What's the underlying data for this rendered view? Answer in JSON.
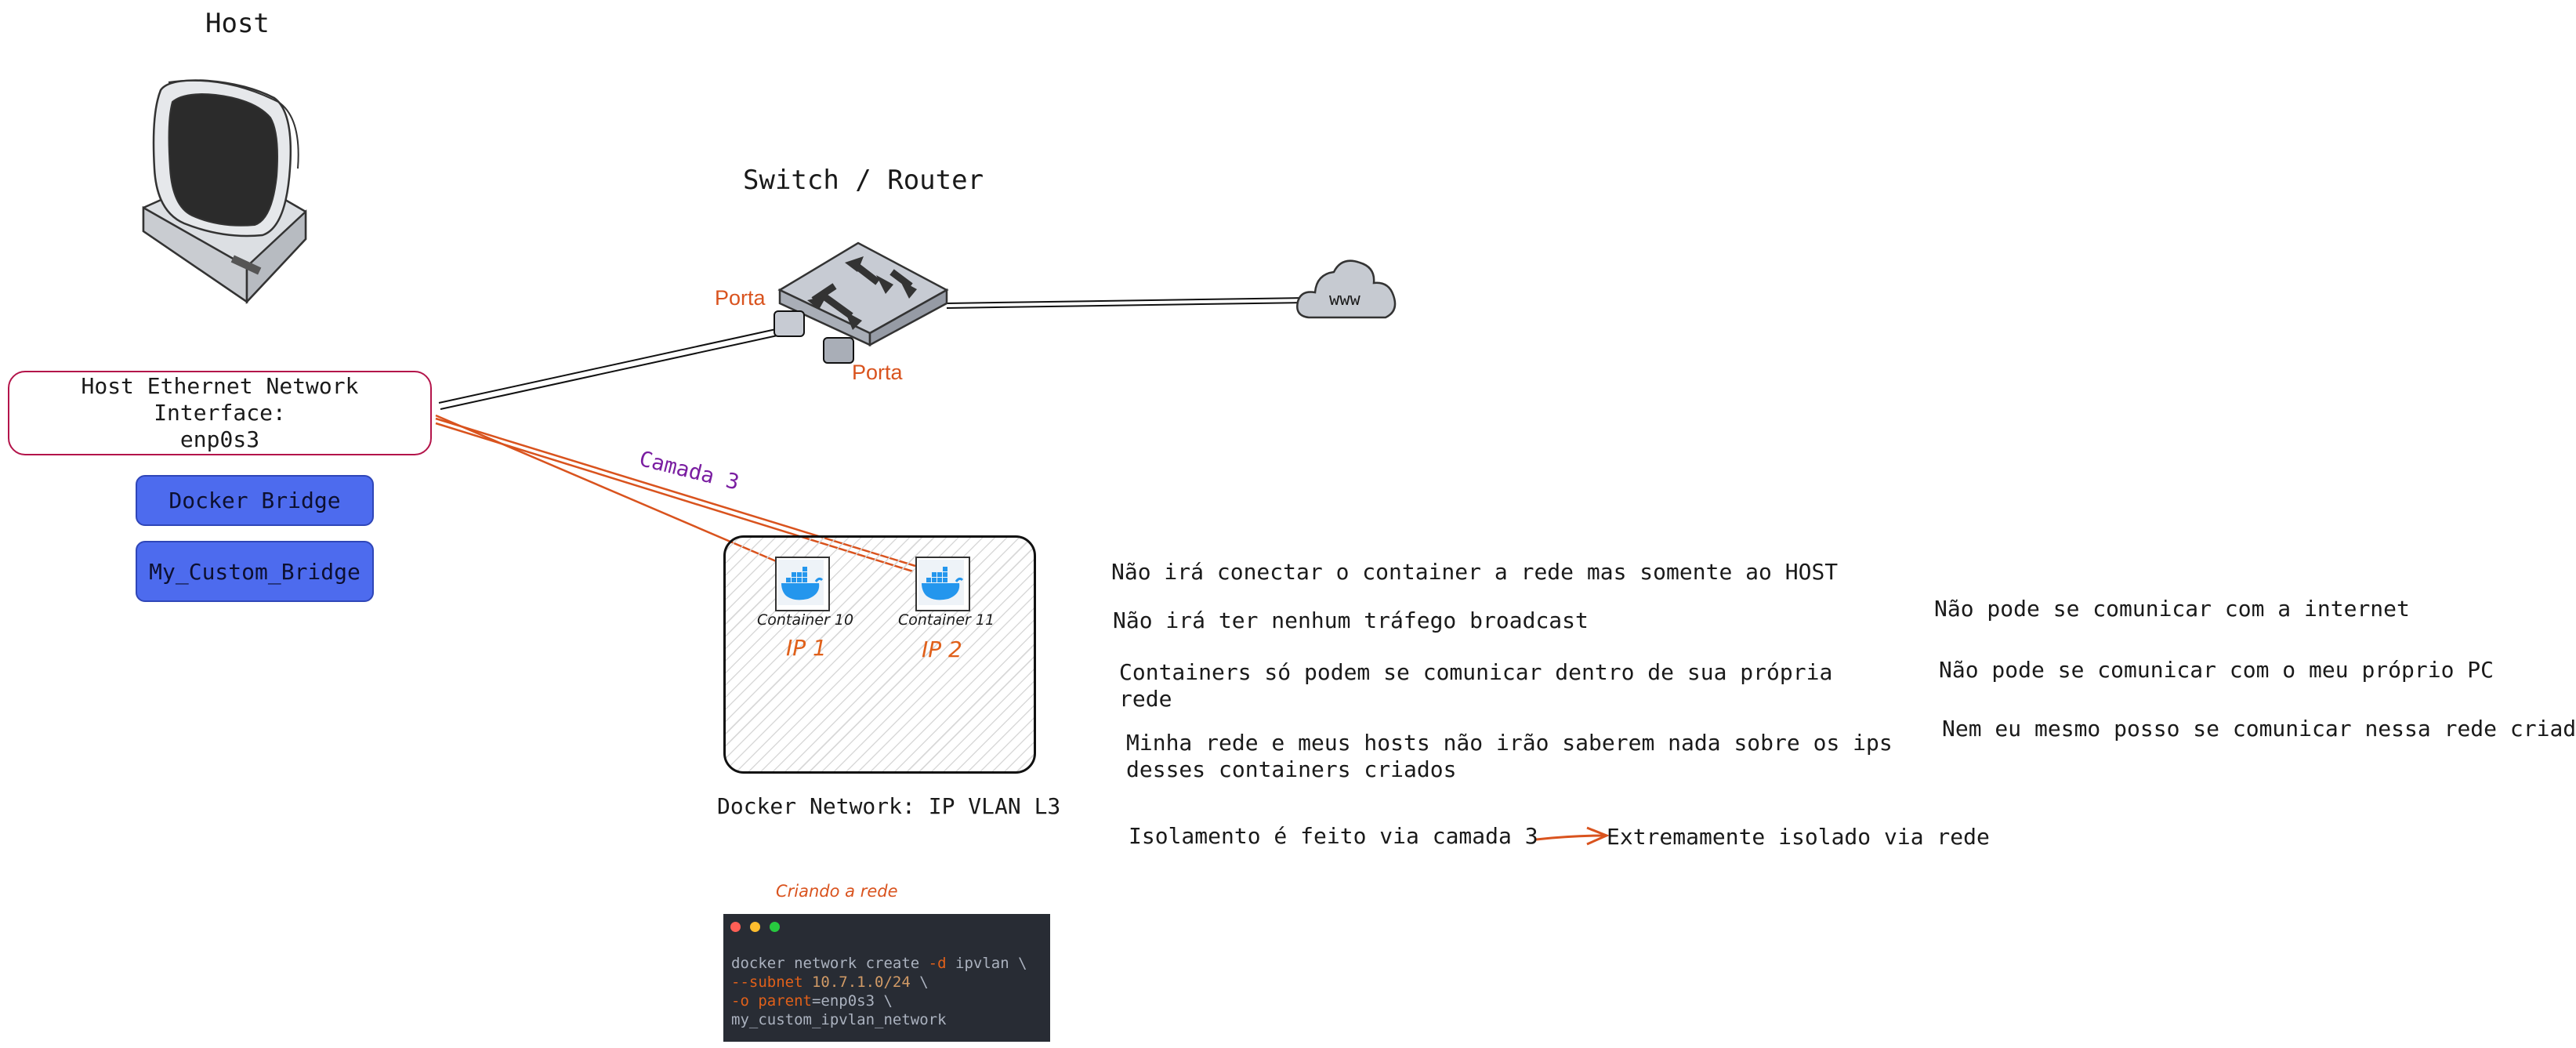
{
  "labels": {
    "host_title": "Host",
    "switch_title": "Switch / Router",
    "porta_1": "Porta",
    "porta_2": "Porta",
    "www": "www",
    "host_iface_line1": "Host Ethernet Network Interface:",
    "host_iface_line2": "enp0s3",
    "camada_3": "Camada 3",
    "docker_bridge": "Docker Bridge",
    "custom_bridge": "My_Custom_Bridge",
    "container_10": "Container 10",
    "container_11": "Container 11",
    "ip_1": "IP 1",
    "ip_2": "IP 2",
    "docker_network": "Docker Network: IP VLAN L3",
    "criando_rede": "Criando a rede"
  },
  "notes": {
    "n1": "Não irá conectar o container a rede mas somente ao HOST",
    "n2": "Não irá ter nenhum tráfego broadcast",
    "n3": "Containers só podem se comunicar dentro de sua própria rede",
    "n4": "Minha rede e meus hosts não irão saberem nada sobre os ips desses containers criados",
    "n5": "Isolamento é feito via camada 3",
    "n6": "Extremamente isolado via rede",
    "r1": "Não pode se comunicar com a internet",
    "r2": "Não pode se comunicar com o meu próprio PC",
    "r3": "Nem eu mesmo posso se comunicar nessa rede criada"
  },
  "terminal": {
    "l1_cmd": "docker network create ",
    "l1_flag": "-d",
    "l1_rest": " ipvlan \\",
    "l2_flag": "--subnet",
    "l2_num": " 10.7.1.0/24",
    "l2_rest": " \\",
    "l3_flag": "-o",
    "l3_key": " parent",
    "l3_rest": "=enp0s3 \\",
    "l4": "my_custom_ipvlan_network"
  },
  "colors": {
    "link_orange": "#d9531e",
    "camada_purple": "#7a1ea1",
    "iface_border": "#b3144a",
    "bridge_fill": "#4d6bee",
    "docker_blue": "#2496ed",
    "terminal_bg": "#282c34"
  },
  "icons": [
    "computer-monitor-icon",
    "network-switch-icon",
    "cloud-icon",
    "docker-whale-icon",
    "arrow-right-icon"
  ]
}
